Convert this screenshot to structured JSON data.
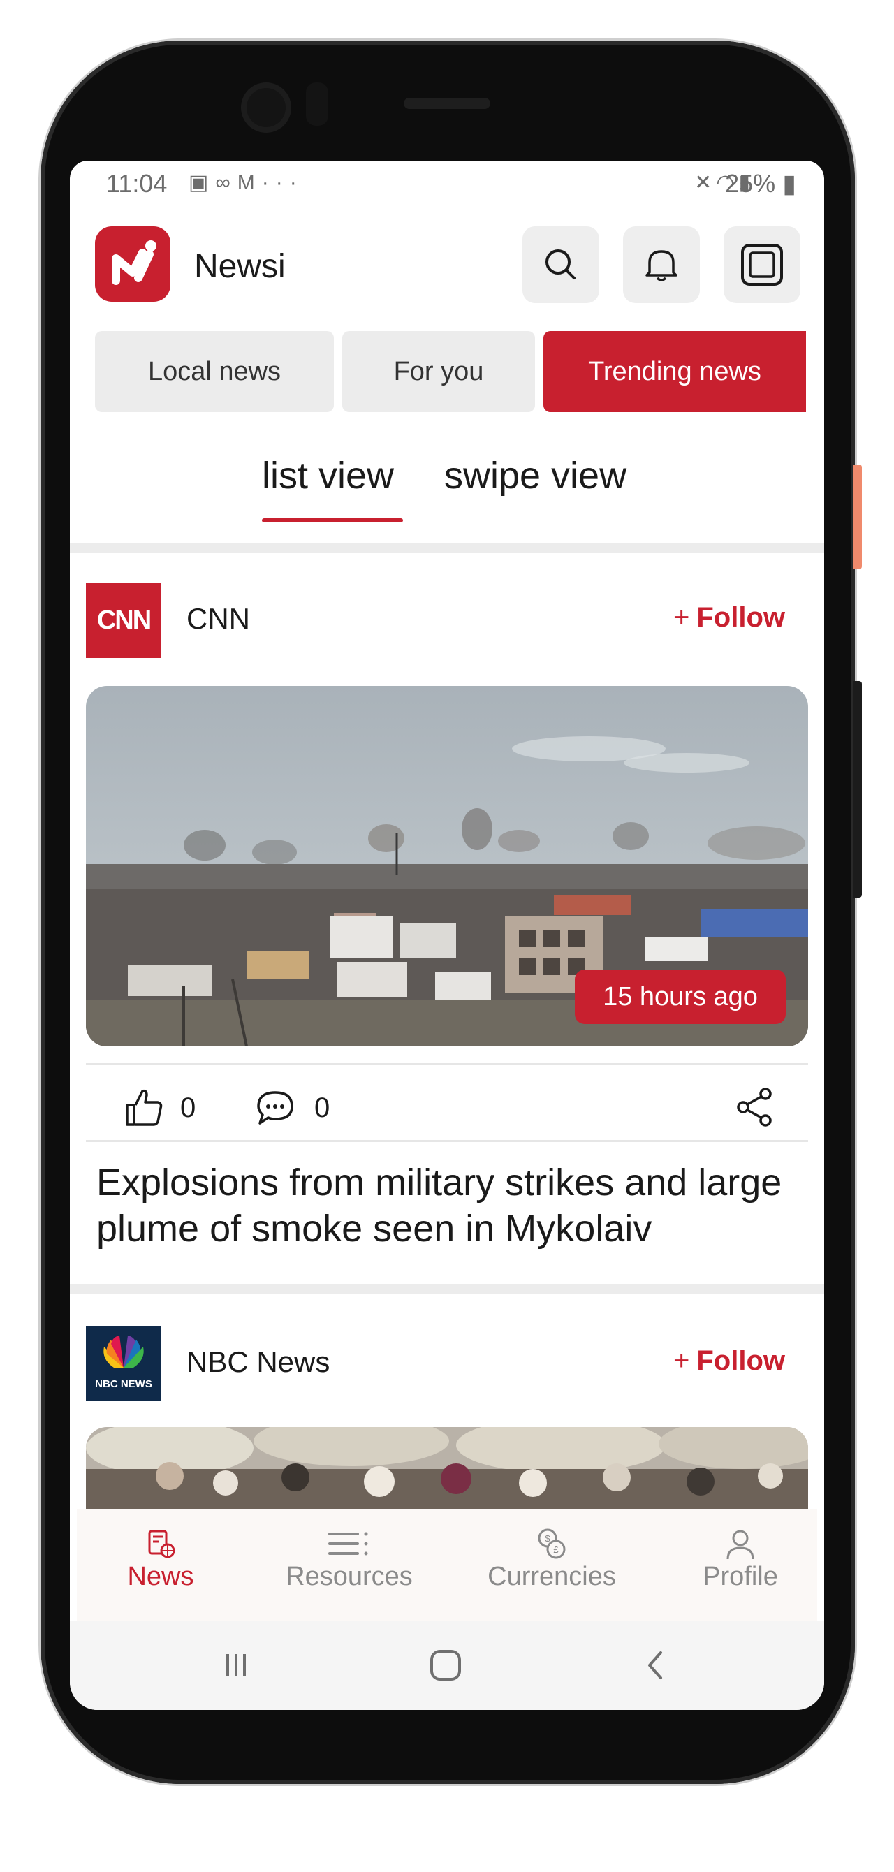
{
  "status_bar": {
    "time": "11:04",
    "left_icons": [
      "image-icon",
      "carrier-icon",
      "gmail-icon",
      "more-dots-icon"
    ],
    "right_icons": [
      "mute-icon",
      "wifi-icon",
      "signal-icon"
    ],
    "battery": "25%"
  },
  "app": {
    "title": "Newsi",
    "accent_color": "#c8202f"
  },
  "header_buttons": [
    "search-icon",
    "bell-icon",
    "instagram-icon"
  ],
  "tabs": [
    {
      "label": "Local news",
      "active": false
    },
    {
      "label": "For you",
      "active": false
    },
    {
      "label": "Trending news",
      "active": true
    }
  ],
  "view_switch": {
    "list": "list view",
    "swipe": "swipe view",
    "active": "list view"
  },
  "articles": [
    {
      "source": "CNN",
      "follow_label": "Follow",
      "follow_plus": "+",
      "time_ago": "15 hours ago",
      "likes": "0",
      "comments": "0",
      "headline": "Explosions from military strikes and large plume of smoke seen in Mykolaiv"
    },
    {
      "source": "NBC News",
      "source_logo_text": "NBC NEWS",
      "follow_label": "Follow",
      "follow_plus": "+"
    }
  ],
  "bottom_nav": [
    {
      "label": "News",
      "icon": "news-icon",
      "active": true
    },
    {
      "label": "Resources",
      "icon": "resources-icon",
      "active": false
    },
    {
      "label": "Currencies",
      "icon": "currencies-icon",
      "active": false
    },
    {
      "label": "Profile",
      "icon": "profile-icon",
      "active": false
    }
  ],
  "system_nav": [
    "recent-apps-icon",
    "home-icon",
    "back-icon"
  ],
  "cnn_logo_text": "CNN"
}
